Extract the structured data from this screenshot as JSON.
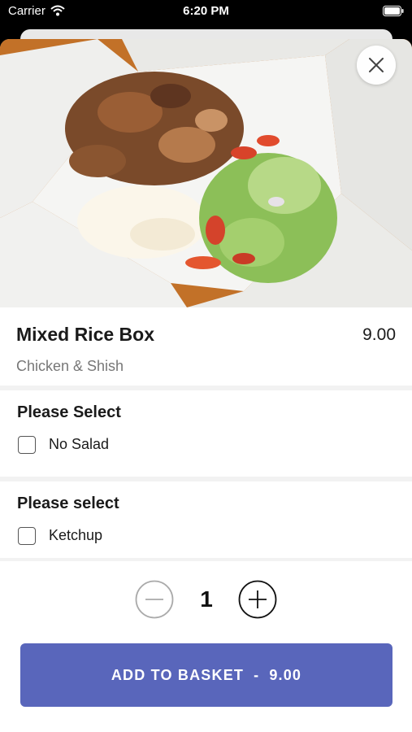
{
  "status_bar": {
    "carrier": "Carrier",
    "time": "6:20 PM"
  },
  "item": {
    "title": "Mixed Rice Box",
    "price": "9.00",
    "subtitle": "Chicken & Shish"
  },
  "option_groups": [
    {
      "title": "Please Select",
      "options": [
        {
          "label": "No Salad",
          "checked": false
        }
      ]
    },
    {
      "title": "Please select",
      "options": [
        {
          "label": "Ketchup",
          "checked": false
        }
      ]
    }
  ],
  "quantity": {
    "value": "1"
  },
  "add_button": {
    "label": "ADD TO BASKET",
    "separator": "-",
    "price": "9.00"
  },
  "colors": {
    "accent": "#5966bb",
    "background_orange": "#c8772b"
  },
  "icons": {
    "close": "close-icon",
    "minus": "minus-icon",
    "plus": "plus-icon"
  }
}
